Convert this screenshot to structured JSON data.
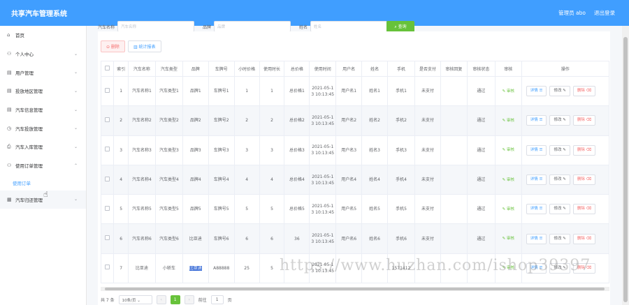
{
  "header": {
    "title": "共享汽车管理系统",
    "user": "管理员 abo",
    "logout": "退出登录"
  },
  "sidebar": {
    "items": [
      {
        "icon": "⌂",
        "label": "首页",
        "chev": ""
      },
      {
        "icon": "⚇",
        "label": "个人中心",
        "chev": "⌄"
      },
      {
        "icon": "▤",
        "label": "用户管理",
        "chev": "⌄"
      },
      {
        "icon": "▤",
        "label": "投放地区管理",
        "chev": "⌄"
      },
      {
        "icon": "▤",
        "label": "汽车信息管理",
        "chev": "⌄"
      },
      {
        "icon": "◷",
        "label": "汽车投放管理",
        "chev": "⌄"
      },
      {
        "icon": "⎙",
        "label": "汽车入库管理",
        "chev": "⌄"
      },
      {
        "icon": "⚇",
        "label": "使用订单管理",
        "chev": "⌃"
      }
    ],
    "sub_item": "使用订单",
    "last_item": {
      "icon": "▦",
      "label": "汽车归还管理",
      "chev": "⌄"
    }
  },
  "search": {
    "label1": "汽车名称",
    "ph1": "汽车名称",
    "label2": "品牌",
    "ph2": "品牌",
    "label3": "姓名",
    "ph3": "姓名",
    "button": "⌕ 查询"
  },
  "toolbar": {
    "delete": "⊝ 删除",
    "report": "▥ 统计报表"
  },
  "table": {
    "headers": [
      "",
      "索引",
      "汽车名称",
      "汽车类型",
      "品牌",
      "车牌号",
      "小时价格",
      "使用时长",
      "总价格",
      "使用时间",
      "用户名",
      "姓名",
      "手机",
      "是否支付",
      "审核回复",
      "审核状态",
      "审核",
      "操作"
    ],
    "rows": [
      [
        "1",
        "汽车名称1",
        "汽车类型1",
        "品牌1",
        "车牌号1",
        "1",
        "1",
        "总价格1",
        "2021-05-13 10:13:45",
        "用户名1",
        "姓名1",
        "手机1",
        "未支付",
        "",
        "通过"
      ],
      [
        "2",
        "汽车名称2",
        "汽车类型2",
        "品牌2",
        "车牌号2",
        "2",
        "2",
        "总价格2",
        "2021-05-13 10:13:45",
        "用户名2",
        "姓名2",
        "手机2",
        "未支付",
        "",
        "通过"
      ],
      [
        "3",
        "汽车名称3",
        "汽车类型3",
        "品牌3",
        "车牌号3",
        "3",
        "3",
        "总价格3",
        "2021-05-13 10:13:45",
        "用户名3",
        "姓名3",
        "手机3",
        "未支付",
        "",
        "通过"
      ],
      [
        "4",
        "汽车名称4",
        "汽车类型4",
        "品牌4",
        "车牌号4",
        "4",
        "4",
        "总价格4",
        "2021-05-13 10:13:45",
        "用户名4",
        "姓名4",
        "手机4",
        "未支付",
        "",
        "通过"
      ],
      [
        "5",
        "汽车名称5",
        "汽车类型5",
        "品牌5",
        "车牌号5",
        "5",
        "5",
        "总价格5",
        "2021-05-13 10:13:45",
        "用户名5",
        "姓名5",
        "手机5",
        "未支付",
        "",
        "通过"
      ],
      [
        "6",
        "汽车名称6",
        "汽车类型6",
        "比亚迪",
        "车牌号6",
        "6",
        "6",
        "36",
        "2021-05-13 10:13:45",
        "用户名6",
        "姓名6",
        "手机6",
        "未支付",
        "",
        "通过"
      ],
      [
        "7",
        "比亚迪",
        "小轿车",
        "比亚迪",
        "A88888",
        "25",
        "5",
        "",
        "2021-05-13 10:13:45",
        "",
        "",
        "1571412",
        "",
        "",
        ""
      ]
    ],
    "audit_label": "✎ 审核",
    "op_detail": "详情 ☰",
    "op_edit": "修改 ✎",
    "op_delete": "删除 ⌫"
  },
  "pager": {
    "total": "共 7 条",
    "size": "10条/页 ⌄",
    "prev": "‹",
    "page": "1",
    "next": "›",
    "goto": "前往",
    "goto_val": "1",
    "page_unit": "页"
  },
  "watermark": "https://www.huzhan.com/ishop39397"
}
